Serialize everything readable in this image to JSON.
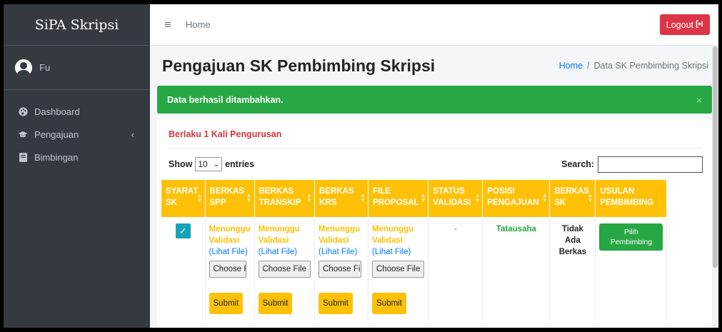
{
  "app": {
    "brand": "SiPA Skripsi",
    "user_name": "Fu"
  },
  "sidebar": {
    "items": [
      {
        "label": "Dashboard",
        "icon": "palette-icon"
      },
      {
        "label": "Pengajuan",
        "icon": "graduation-cap-icon",
        "chevron": "‹"
      },
      {
        "label": "Bimbingan",
        "icon": "book-icon"
      }
    ]
  },
  "topbar": {
    "menu_icon": "≡",
    "home_label": "Home",
    "logout_label": "Logout"
  },
  "header": {
    "title": "Pengajuan SK Pembimbing Skripsi",
    "breadcrumb_home": "Home",
    "breadcrumb_sep": "/",
    "breadcrumb_current": "Data SK Pembimbing Skripsi"
  },
  "alert": {
    "message": "Data berhasil ditambahkan.",
    "close": "×"
  },
  "card": {
    "title": "Berlaku 1 Kali Pengurusan",
    "show_label": "Show",
    "entries_value": "10",
    "entries_label": "entries",
    "search_label": "Search:",
    "search_value": ""
  },
  "table": {
    "headers": [
      [
        "SYARAT",
        "SK"
      ],
      [
        "BERKAS",
        "SPP"
      ],
      [
        "BERKAS",
        "TRANSKIP"
      ],
      [
        "BERKAS",
        "KRS"
      ],
      [
        "FILE",
        "PROPOSAL"
      ],
      [
        "STATUS",
        "VALIDASI"
      ],
      [
        "POSISI",
        "PENGAJUAN"
      ],
      [
        "BERKAS",
        "SK"
      ],
      [
        "USULAN",
        "PEMBIMBING"
      ]
    ],
    "row": {
      "status_line1": "Menunggu",
      "status_line2": "Validasi",
      "lihat": "(Lihat File)",
      "file_spp": "Choose Fi",
      "file_transkip": "Choose File",
      "file_krs": "Choose Fi",
      "file_proposal": "Choose File",
      "submit": "Submit",
      "status_validasi": "-",
      "posisi": "Tatausaha",
      "berkas_sk_line1": "Tidak Ada",
      "berkas_sk_line2": "Berkas",
      "pilih_line1": "Pilih",
      "pilih_line2": "Pembimbing"
    }
  },
  "colors": {
    "sidebar": "#343a40",
    "header_yellow": "#ffc107",
    "success": "#28a745",
    "danger": "#dc3545",
    "info": "#17a2b8",
    "link": "#007bff"
  }
}
